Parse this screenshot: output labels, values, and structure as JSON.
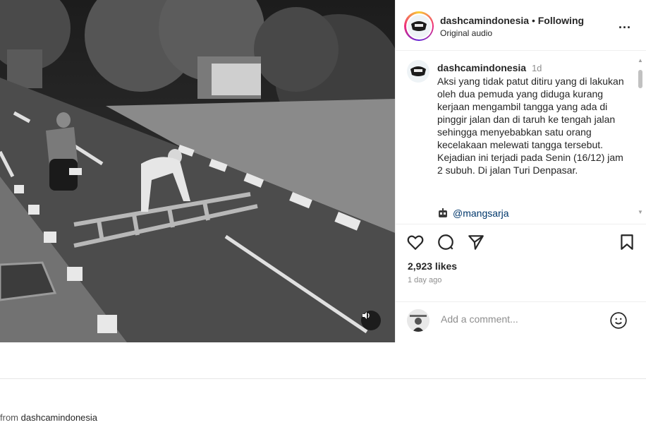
{
  "header": {
    "username": "dashcamindonesia",
    "separator": "•",
    "follow_status": "Following",
    "audio": "Original audio",
    "more": "..."
  },
  "caption": {
    "username": "dashcamindonesia",
    "time": "1d",
    "text": "Aksi yang tidak patut ditiru yang di lakukan oleh dua pemuda yang diduga kurang kerjaan mengambil tangga yang ada di pinggir jalan dan di taruh ke tengah jalan sehingga menyebabkan satu orang kecelakaan melewati tangga tersebut. Kejadian ini terjadi pada Senin (16/12) jam 2 subuh. Di jalan Turi Denpasar.",
    "mention": "@mangsarja"
  },
  "actions": {
    "likes": "2,923 likes",
    "time_ago": "1 day ago"
  },
  "comment": {
    "placeholder": "Add a comment..."
  },
  "footer": {
    "from_prefix": "from",
    "from_user": "dashcamindonesia"
  },
  "icons": {
    "like": "heart-icon",
    "comment": "comment-icon",
    "share": "send-icon",
    "save": "bookmark-icon",
    "emoji": "emoji-icon",
    "sound": "speaker-icon",
    "mention_avatar": "robot-icon"
  }
}
